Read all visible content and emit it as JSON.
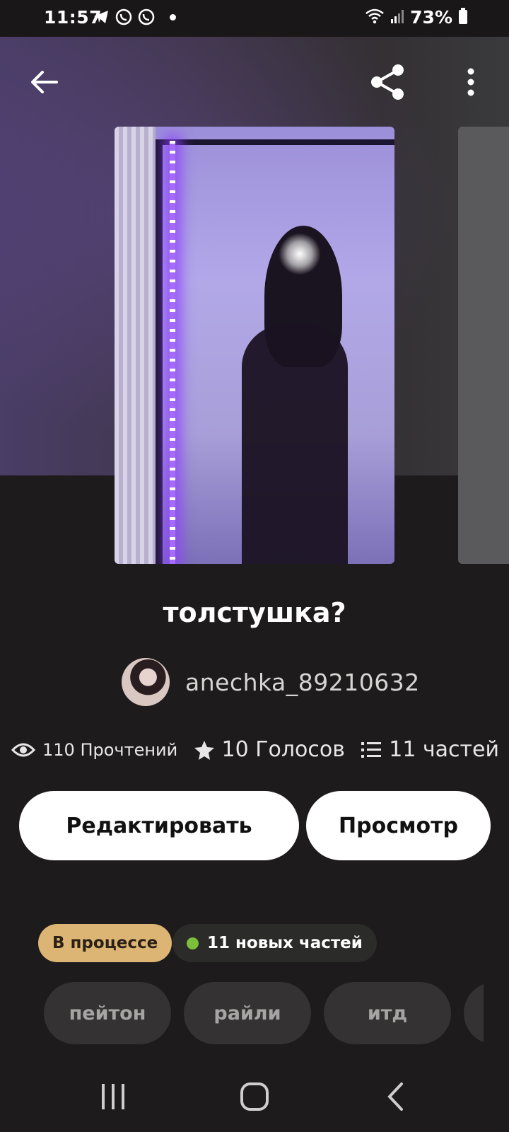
{
  "status_bar": {
    "time": "11:57",
    "battery": "73%",
    "icons": [
      "telegram-icon",
      "viber-icon",
      "viber-icon",
      "notification-dot",
      "wifi-icon",
      "signal-icon",
      "battery-icon"
    ]
  },
  "toolbar": {
    "back_icon": "back-arrow-icon",
    "share_icon": "share-icon",
    "more_icon": "more-vertical-icon"
  },
  "story": {
    "title": "толстушка?",
    "author": "anechka_89210632",
    "stats": {
      "reads": "110 Прочтений",
      "votes": "10 Голосов",
      "parts": "11 частей"
    },
    "edit_label": "Редактировать",
    "view_label": "Просмотр",
    "status_label": "В процессе",
    "new_parts_label": "11 новых частей",
    "tags": [
      "пейтон",
      "райли",
      "итд",
      ""
    ]
  },
  "colors": {
    "background": "#1e1b1c",
    "status_chip": "#dcb574",
    "new_dot": "#7bbf3a"
  }
}
